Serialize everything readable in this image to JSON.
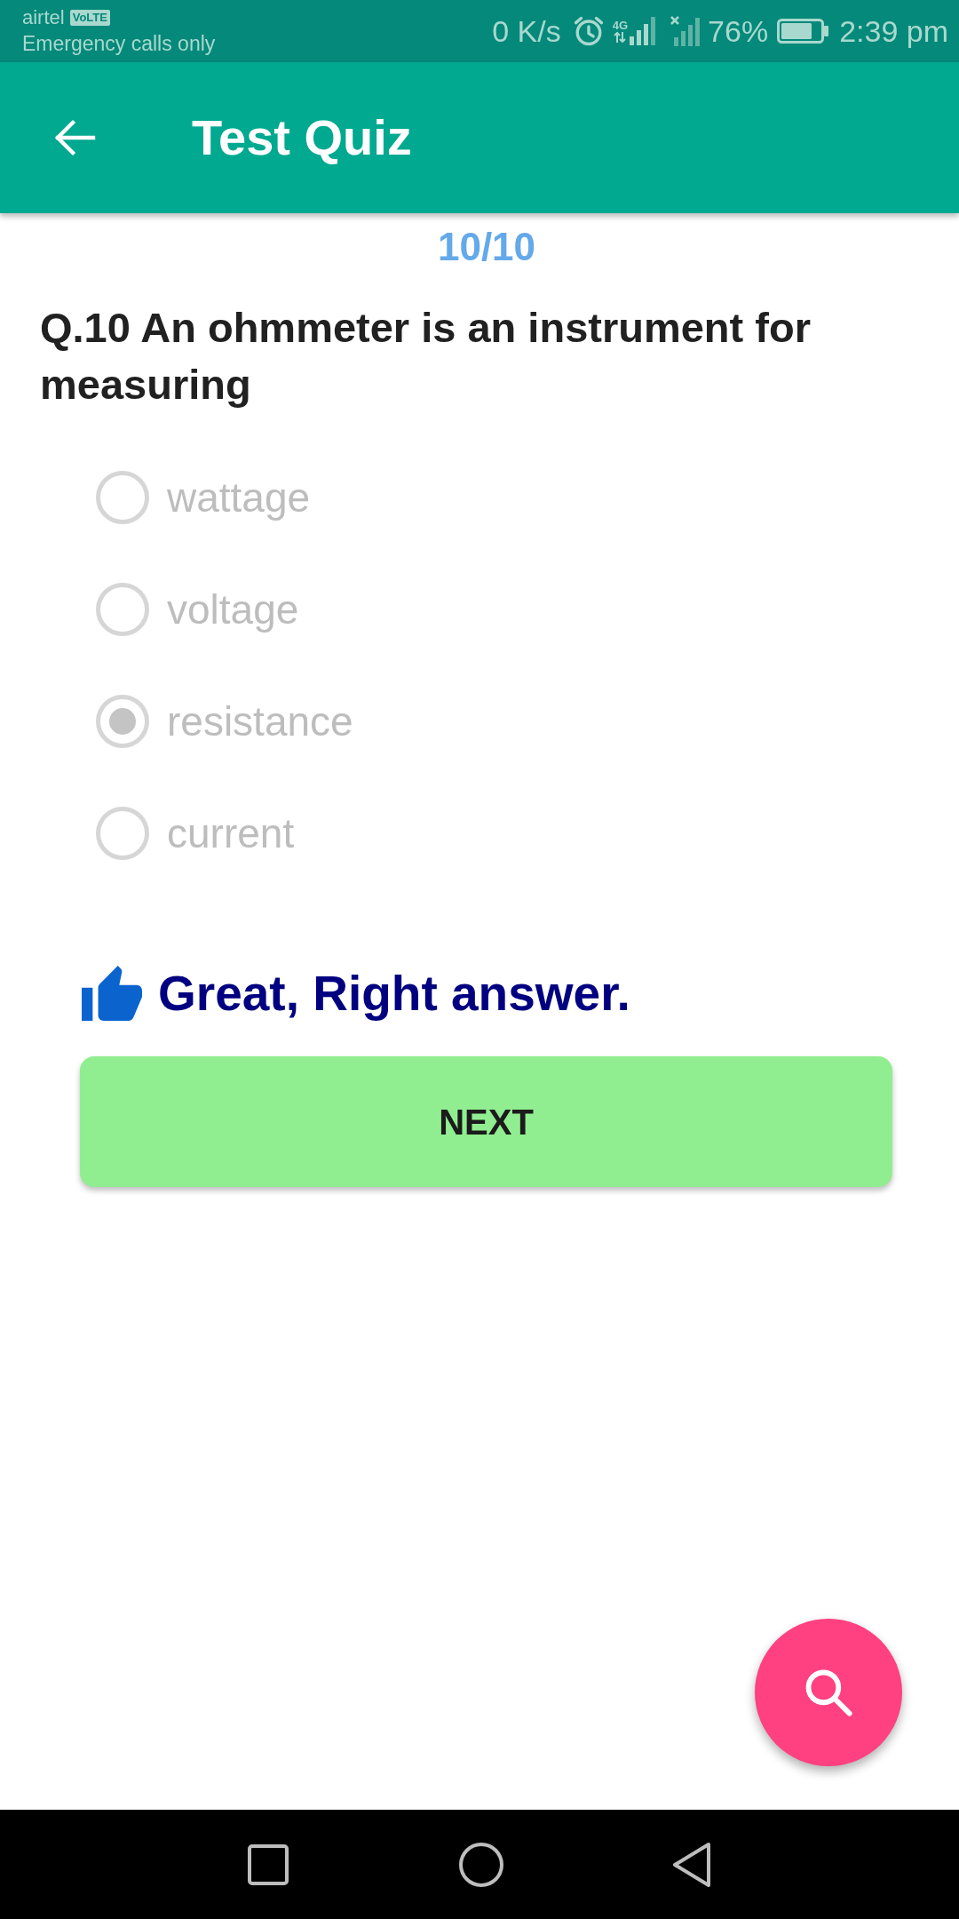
{
  "status_bar": {
    "carrier": "airtel",
    "carrier_badge": "VoLTE",
    "network_note": "Emergency calls only",
    "net_speed": "0 K/s",
    "network_type": "4G",
    "battery_percent": "76%",
    "time": "2:39 pm"
  },
  "app_bar": {
    "title": "Test Quiz"
  },
  "progress": "10/10",
  "question": "Q.10 An ohmmeter is an instrument for measuring",
  "options": [
    {
      "label": "wattage",
      "selected": false,
      "disabled": true
    },
    {
      "label": "voltage",
      "selected": false,
      "disabled": true
    },
    {
      "label": "resistance",
      "selected": true,
      "disabled": true
    },
    {
      "label": "current",
      "selected": false,
      "disabled": true
    }
  ],
  "feedback": {
    "correct": true,
    "text": "Great, Right answer."
  },
  "next_button": {
    "label": "NEXT"
  }
}
